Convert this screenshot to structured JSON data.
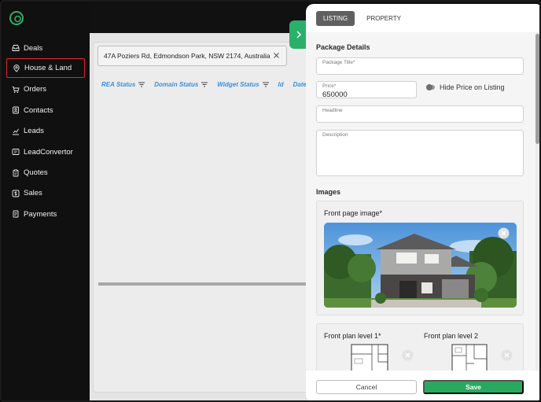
{
  "sidebar": {
    "items": [
      {
        "label": "Deals",
        "icon": "inbox-icon"
      },
      {
        "label": "House & Land",
        "icon": "map-pin-icon"
      },
      {
        "label": "Orders",
        "icon": "cart-icon"
      },
      {
        "label": "Contacts",
        "icon": "contacts-icon"
      },
      {
        "label": "Leads",
        "icon": "chart-icon"
      },
      {
        "label": "LeadConvertor",
        "icon": "convert-icon"
      },
      {
        "label": "Quotes",
        "icon": "clipboard-icon"
      },
      {
        "label": "Sales",
        "icon": "dollar-icon"
      },
      {
        "label": "Payments",
        "icon": "document-icon"
      }
    ]
  },
  "main": {
    "filter_chip": "47A Poziers Rd, Edmondson Park, NSW 2174, Australia",
    "columns": [
      "REA Status",
      "Domain Status",
      "Widget Status",
      "Id",
      "Date"
    ]
  },
  "drawer": {
    "tabs": [
      "LISTING",
      "PROPERTY"
    ],
    "package_details_title": "Package Details",
    "package_title_label": "Package Title*",
    "price_label": "Price*",
    "price_value": "650000",
    "hide_price_label": "Hide Price on Listing",
    "headline_label": "Headline",
    "description_label": "Description",
    "images_title": "Images",
    "front_page_image_label": "Front page image*",
    "front_plan_1_label": "Front plan level 1*",
    "front_plan_2_label": "Front plan level 2",
    "cancel_label": "Cancel",
    "save_label": "Save"
  },
  "colors": {
    "accent_green": "#2aa860",
    "active_nav_border": "#e0262b",
    "column_header_blue": "#3b8ed6"
  }
}
